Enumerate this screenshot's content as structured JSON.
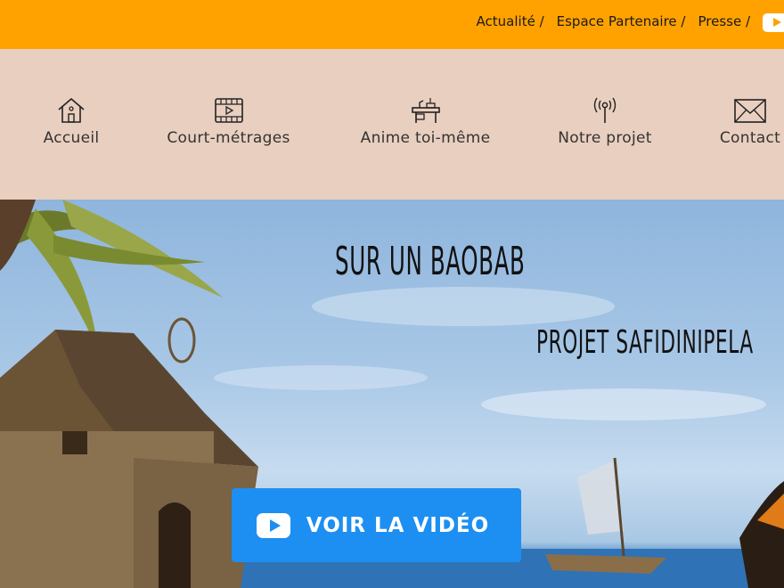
{
  "topbar": {
    "links": [
      "Actualité /",
      "Espace Partenaire /",
      "Presse /"
    ],
    "youtube_icon": "youtube-icon",
    "color": "#ffa200"
  },
  "nav": {
    "items": [
      {
        "label": "Accueil",
        "icon": "home-icon"
      },
      {
        "label": "Court-métrages",
        "icon": "film-icon"
      },
      {
        "label": "Anime toi-même",
        "icon": "desk-icon"
      },
      {
        "label": "Notre projet",
        "icon": "antenna-icon"
      },
      {
        "label": "Contact",
        "icon": "envelope-icon"
      }
    ],
    "background": "#e9cfbf"
  },
  "hero": {
    "title": "SUR UN BAOBAB",
    "subtitle": "PROJET SAFIDINIPELA",
    "cta_label": "VOIR LA VIDÉO",
    "cta_icon": "youtube-play-icon",
    "cta_color": "#1d8ff2"
  }
}
